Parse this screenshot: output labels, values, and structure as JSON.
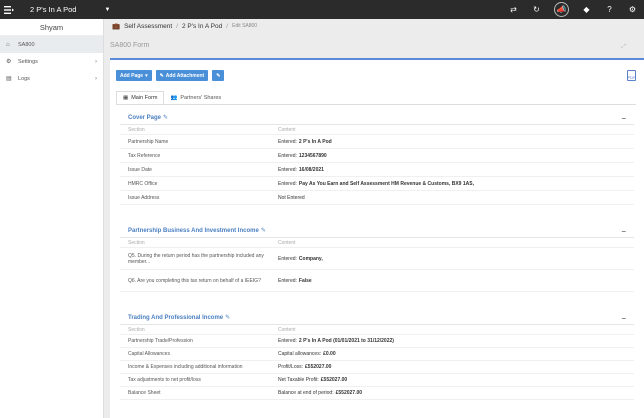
{
  "topbar": {
    "client_name": "2 P's In A Pod",
    "icons": [
      "transfer-icon",
      "refresh-icon",
      "megaphone-icon",
      "tag-icon",
      "help-icon",
      "settings-icon"
    ]
  },
  "sidebar": {
    "user": "Shyam",
    "items": [
      {
        "label": "SA800",
        "icon": "home-icon"
      },
      {
        "label": "Settings",
        "icon": "gear-icon"
      },
      {
        "label": "Logs",
        "icon": "document-icon"
      }
    ]
  },
  "breadcrumb": {
    "section": "Self Assessment",
    "client": "2 P's In A Pod",
    "page": "Edit SA800"
  },
  "page": {
    "title": "SA800 Form"
  },
  "toolbar": {
    "add_page": "Add Page",
    "add_attachment": "Add Attachment"
  },
  "tabs": {
    "main_form": "Main Form",
    "partners_shares": "Partners' Shares"
  },
  "sections": [
    {
      "title": "Cover Page",
      "col_section": "Section",
      "col_content": "Content",
      "rows": [
        {
          "section": "Partnership Name",
          "status": "Entered:",
          "value": "2 P's In A Pod"
        },
        {
          "section": "Tax Reference",
          "status": "Entered:",
          "value": "1234567890"
        },
        {
          "section": "Issue Date",
          "status": "Entered:",
          "value": "16/08/2021"
        },
        {
          "section": "HMRC Office",
          "status": "Entered:",
          "value": "Pay As You Earn and Self Assessment HM Revenue & Customs, BX9 1AS,"
        },
        {
          "section": "Issue Address",
          "status": "Not Entered",
          "value": ""
        }
      ]
    },
    {
      "title": "Partnership Business And Investment Income",
      "col_section": "Section",
      "col_content": "Content",
      "rows": [
        {
          "section": "Q5. During the return period has the partnership included any member...",
          "status": "Entered:",
          "value": "Company,"
        },
        {
          "section": "Q6. Are you completing this tax return on behalf of a IEEIG?",
          "status": "Entered:",
          "value": "False"
        }
      ]
    },
    {
      "title": "Trading And Professional Income",
      "col_section": "Section",
      "col_content": "Content",
      "rows": [
        {
          "section": "Partnership Trade/Profession",
          "status": "Entered:",
          "value": "2 P's In A Pod (01/01/2021 to 31/12/2022)"
        },
        {
          "section": "Capital Allowances",
          "status": "Capital allowances:",
          "value": "£0.00"
        },
        {
          "section": "Income & Expenses including additional information",
          "status": "Profit/Loss:",
          "value": "£552027.00"
        },
        {
          "section": "Tax adjustments to net profit/loss",
          "status": "Net Taxable Profit:",
          "value": "£552027.00"
        },
        {
          "section": "Balance Sheet",
          "status": "Balance at end of period:",
          "value": "£552027.00"
        }
      ]
    }
  ],
  "colors": {
    "topbar": "#2b2b2b",
    "accent": "#4a90d9",
    "section_title": "#4a7fc1"
  }
}
